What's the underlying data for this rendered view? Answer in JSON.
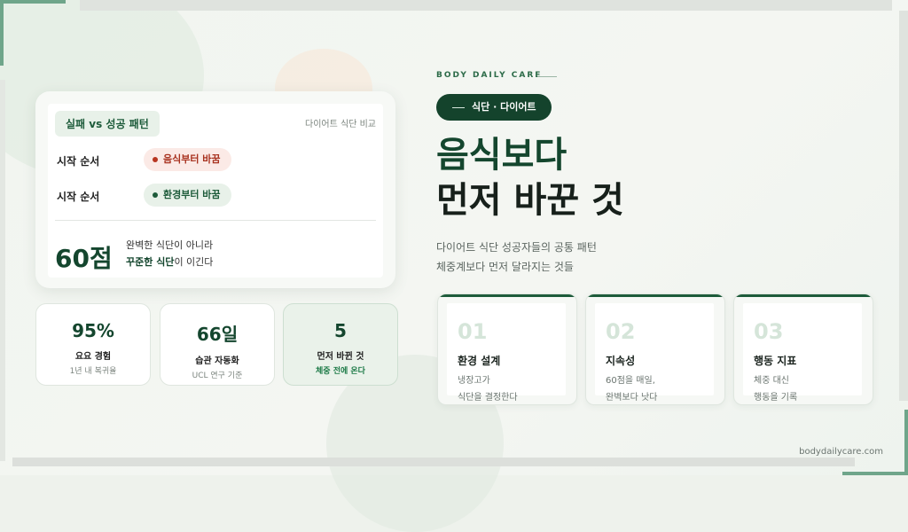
{
  "compare_card": {
    "tag": "실패 vs 성공 패턴",
    "note": "다이어트 식단 비교",
    "rows": [
      {
        "label": "시작 순서",
        "value": "음식부터 바꿈"
      },
      {
        "label": "시작 순서",
        "value": "환경부터 바꿈"
      }
    ],
    "score": "60점",
    "score_line1": "완벽한 식단이 아니라",
    "score_line2_bold": "꾸준한 식단",
    "score_line2_rest": "이 이긴다"
  },
  "stats": [
    {
      "value": "95%",
      "label": "요요 경험",
      "sub": "1년 내 복귀율"
    },
    {
      "value": "66일",
      "label": "습관 자동화",
      "sub": "UCL 연구 기준"
    },
    {
      "value": "5",
      "label": "먼저 바뀐 것",
      "sub": "체중 전에 온다"
    }
  ],
  "hero": {
    "eyebrow": "BODY DAILY CARE",
    "badge": "식단 · 다이어트",
    "headline_line1": "음식보다",
    "headline_line2": "먼저 바꾼 것",
    "desc_line1": "다이어트 식단 성공자들의 공통 패턴",
    "desc_line2": "체중계보다 먼저 달라지는 것들"
  },
  "features": [
    {
      "num": "01",
      "title": "환경 설계",
      "line1": "냉장고가",
      "line2": "식단을 결정한다"
    },
    {
      "num": "02",
      "title": "지속성",
      "line1": "60점을 매일,",
      "line2": "완벽보다 낫다"
    },
    {
      "num": "03",
      "title": "행동 지표",
      "line1": "체중 대신",
      "line2": "행동을 기록"
    }
  ],
  "site": "bodydailycare.com",
  "colors": {
    "brand_dark": "#14432c",
    "brand": "#1d5b3a",
    "accent_red": "#b83520"
  }
}
